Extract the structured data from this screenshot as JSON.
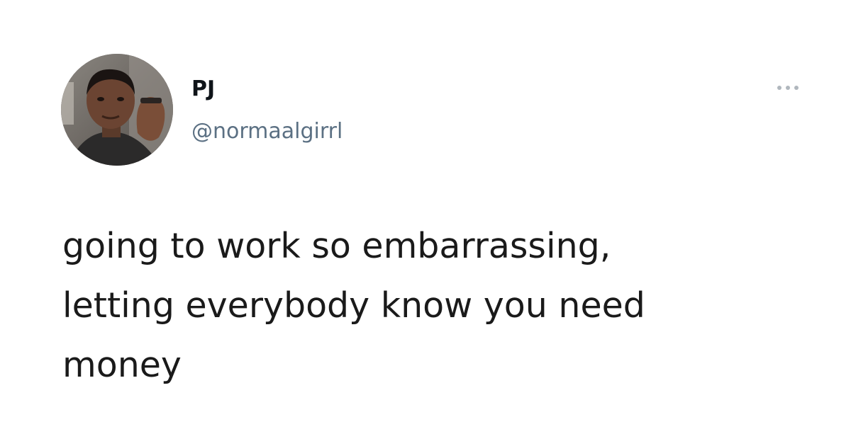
{
  "tweet": {
    "display_name": "PJ",
    "handle": "@normaalgirrl",
    "text": "going to work so embarrassing,\nletting everybody know you need\nmoney",
    "avatar_icon": "profile-photo",
    "more_icon": "more-horizontal-icon"
  },
  "colors": {
    "background": "#ffffff",
    "name": "#0f1419",
    "handle": "#5b7083",
    "text": "#1a1a1a"
  }
}
